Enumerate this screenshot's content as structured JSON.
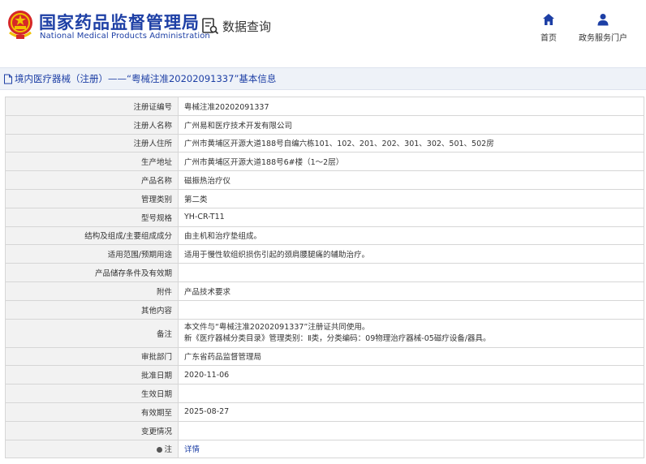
{
  "header": {
    "site_name_cn": "国家药品监督管理局",
    "site_name_en": "National Medical Products Administration",
    "query_label": "数据查询",
    "nav_home": "首页",
    "nav_service": "政务服务门户",
    "brand_color": "#1d3fa5"
  },
  "titlebar": {
    "text": "境内医疗器械（注册）——“粤械注准20202091337”基本信息"
  },
  "rows": [
    {
      "key": "注册证编号",
      "value": "粤械注准20202091337"
    },
    {
      "key": "注册人名称",
      "value": "广州易和医疗技术开发有限公司"
    },
    {
      "key": "注册人住所",
      "value": "广州市黄埔区开源大道188号自编六栋101、102、201、202、301、302、501、502房"
    },
    {
      "key": "生产地址",
      "value": "广州市黄埔区开源大道188号6#楼（1～2层）"
    },
    {
      "key": "产品名称",
      "value": "磁振热治疗仪"
    },
    {
      "key": "管理类别",
      "value": "第二类"
    },
    {
      "key": "型号规格",
      "value": "YH-CR-T11"
    },
    {
      "key": "结构及组成/主要组成成分",
      "value": "由主机和治疗垫组成。"
    },
    {
      "key": "适用范围/预期用途",
      "value": "适用于慢性软组织损伤引起的颈肩腰腿痛的辅助治疗。"
    },
    {
      "key": "产品储存条件及有效期",
      "value": ""
    },
    {
      "key": "附件",
      "value": "产品技术要求"
    },
    {
      "key": "其他内容",
      "value": ""
    },
    {
      "key": "备注",
      "value_line1": "本文件与“粤械注准20202091337”注册证共同使用。",
      "value_line2": "新《医疗器械分类目录》管理类别：Ⅱ类，分类编码：09物理治疗器械-05磁疗设备/器具。"
    },
    {
      "key": "审批部门",
      "value": "广东省药品监督管理局"
    },
    {
      "key": "批准日期",
      "value": "2020-11-06"
    },
    {
      "key": "生效日期",
      "value": ""
    },
    {
      "key": "有效期至",
      "value": "2025-08-27"
    },
    {
      "key": "变更情况",
      "value": ""
    },
    {
      "key": "注",
      "value": "详情"
    }
  ]
}
